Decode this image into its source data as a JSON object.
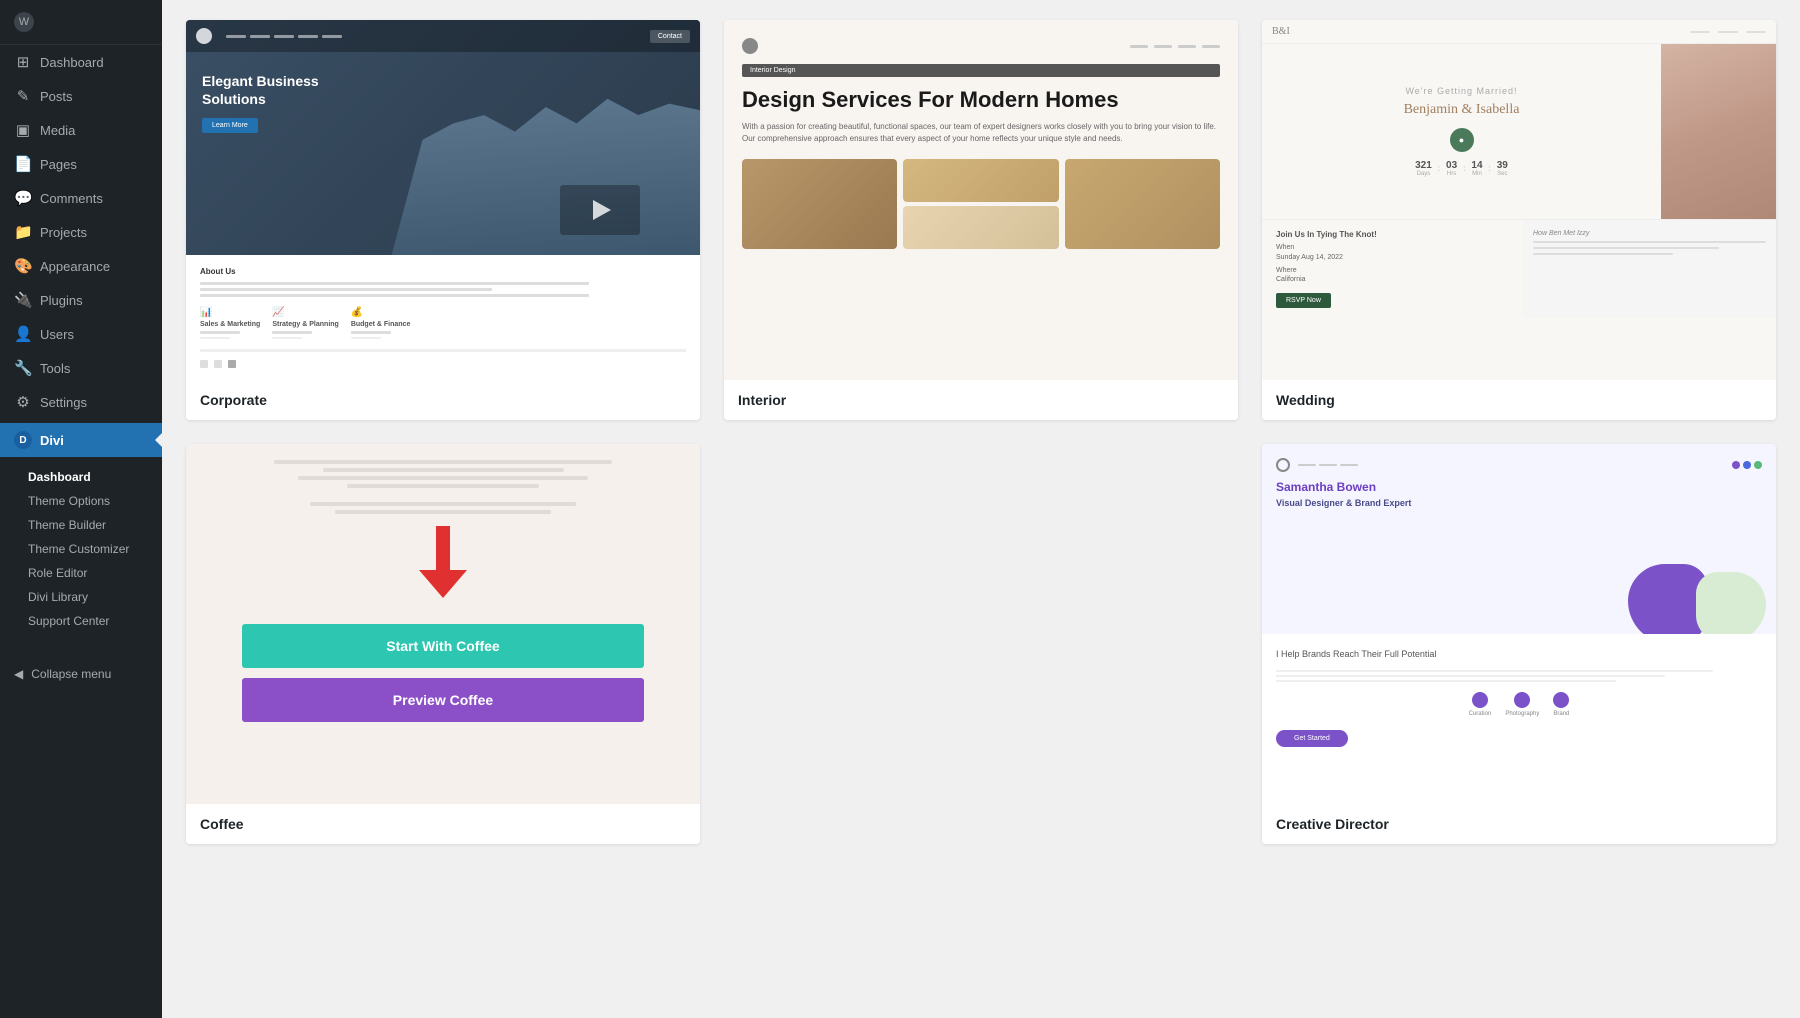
{
  "sidebar": {
    "logo_label": "WordPress",
    "nav_items": [
      {
        "id": "dashboard",
        "label": "Dashboard",
        "icon": "⊞"
      },
      {
        "id": "posts",
        "label": "Posts",
        "icon": "✎"
      },
      {
        "id": "media",
        "label": "Media",
        "icon": "⬛"
      },
      {
        "id": "pages",
        "label": "Pages",
        "icon": "📄"
      },
      {
        "id": "comments",
        "label": "Comments",
        "icon": "💬"
      },
      {
        "id": "projects",
        "label": "Projects",
        "icon": "📁"
      },
      {
        "id": "appearance",
        "label": "Appearance",
        "icon": "🎨"
      },
      {
        "id": "plugins",
        "label": "Plugins",
        "icon": "🔌"
      },
      {
        "id": "users",
        "label": "Users",
        "icon": "👤"
      },
      {
        "id": "tools",
        "label": "Tools",
        "icon": "🔧"
      },
      {
        "id": "settings",
        "label": "Settings",
        "icon": "⚙"
      }
    ],
    "divi_label": "Divi",
    "divi_submenu": [
      {
        "id": "dashboard",
        "label": "Dashboard"
      },
      {
        "id": "theme-options",
        "label": "Theme Options"
      },
      {
        "id": "theme-builder",
        "label": "Theme Builder"
      },
      {
        "id": "theme-customizer",
        "label": "Theme Customizer"
      },
      {
        "id": "role-editor",
        "label": "Role Editor"
      },
      {
        "id": "divi-library",
        "label": "Divi Library"
      },
      {
        "id": "support-center",
        "label": "Support Center"
      }
    ],
    "collapse_label": "Collapse menu"
  },
  "themes": [
    {
      "id": "corporate",
      "label": "Corporate",
      "type": "corporate"
    },
    {
      "id": "interior",
      "label": "Interior",
      "type": "interior",
      "title": "Design Services For Modern Homes",
      "subtitle": "With a passion for creating beautiful, functional spaces, our team of expert designers works closely with you to bring your vision to life. Our comprehensive approach ensures that every aspect of your home reflects your unique style and needs."
    },
    {
      "id": "wedding",
      "label": "Wedding",
      "type": "wedding",
      "name": "Benjamin & Isabella",
      "how_met": "How Ben Met Izzy"
    },
    {
      "id": "coffee",
      "label": "Coffee",
      "type": "coffee",
      "btn_start": "Start With Coffee",
      "btn_preview": "Preview Coffee"
    },
    {
      "id": "creative-director",
      "label": "Creative Director",
      "type": "creative",
      "name": "Samantha Bowen",
      "title": "Visual Designer & Brand Expert"
    }
  ]
}
